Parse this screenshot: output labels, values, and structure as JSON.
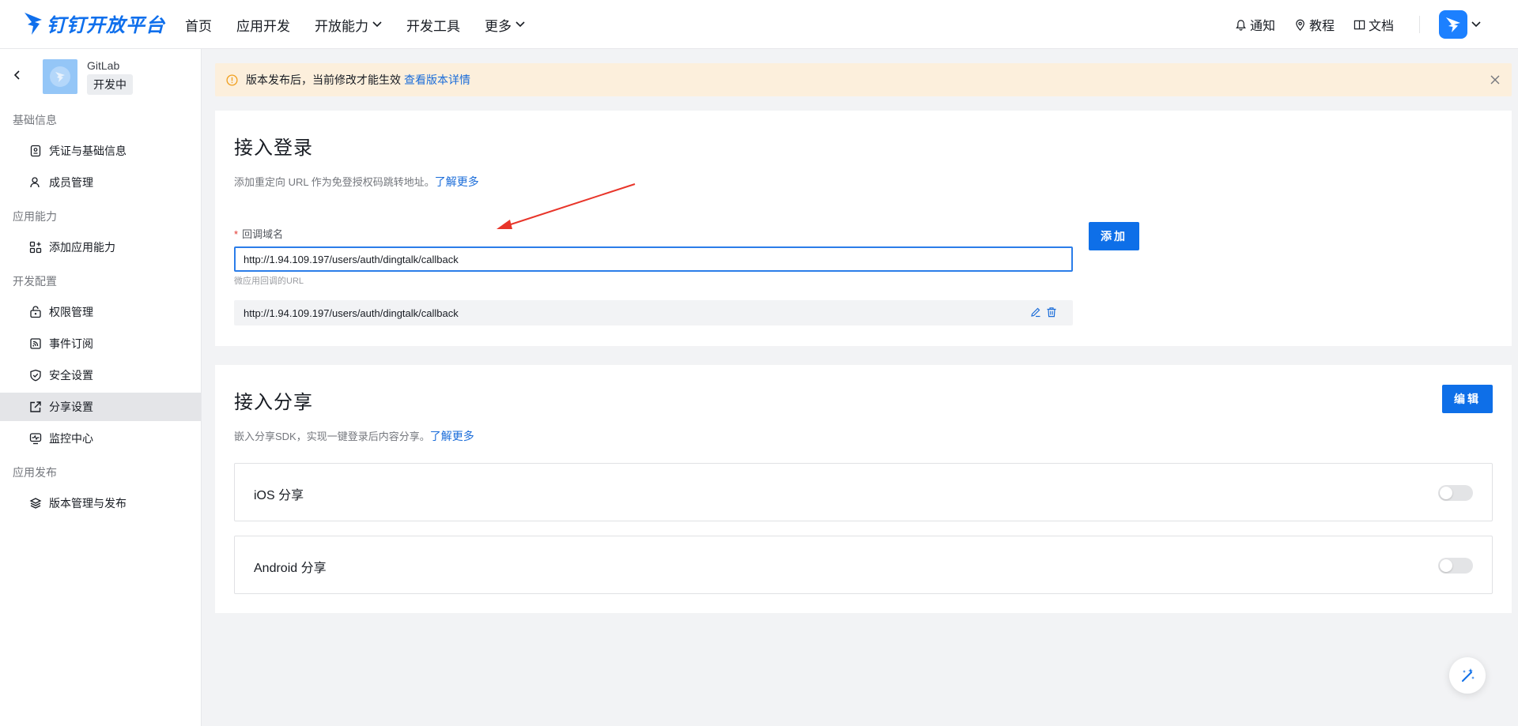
{
  "brand": {
    "name": "钉钉开放平台",
    "color": "#0f6fec",
    "logo_icon": "dingtalk-logo-icon"
  },
  "nav": {
    "items": [
      {
        "label": "首页",
        "has_dropdown": false
      },
      {
        "label": "应用开发",
        "has_dropdown": false
      },
      {
        "label": "开放能力",
        "has_dropdown": true
      },
      {
        "label": "开发工具",
        "has_dropdown": false
      },
      {
        "label": "更多",
        "has_dropdown": true
      }
    ],
    "right": {
      "notify": "通知",
      "tutorial": "教程",
      "docs": "文档"
    }
  },
  "app": {
    "name": "GitLab",
    "status": "开发中"
  },
  "sidebar": {
    "groups": [
      {
        "title": "基础信息",
        "items": [
          {
            "label": "凭证与基础信息",
            "icon": "credential-icon"
          },
          {
            "label": "成员管理",
            "icon": "user-icon"
          }
        ]
      },
      {
        "title": "应用能力",
        "items": [
          {
            "label": "添加应用能力",
            "icon": "apps-add-icon"
          }
        ]
      },
      {
        "title": "开发配置",
        "items": [
          {
            "label": "权限管理",
            "icon": "permission-icon"
          },
          {
            "label": "事件订阅",
            "icon": "event-icon"
          },
          {
            "label": "安全设置",
            "icon": "shield-icon"
          },
          {
            "label": "分享设置",
            "icon": "share-icon",
            "active": true
          },
          {
            "label": "监控中心",
            "icon": "monitor-icon"
          }
        ]
      },
      {
        "title": "应用发布",
        "items": [
          {
            "label": "版本管理与发布",
            "icon": "layers-icon"
          }
        ]
      }
    ]
  },
  "alert": {
    "text": "版本发布后，当前修改才能生效",
    "link": "查看版本详情",
    "background": "#fcefdc",
    "icon_color": "#f0a020"
  },
  "login_card": {
    "title": "接入登录",
    "desc": "添加重定向 URL 作为免登授权码跳转地址。",
    "desc_link": "了解更多",
    "field_label": "回调域名",
    "required_mark": "*",
    "input_value": "http://1.94.109.197/users/auth/dingtalk/callback",
    "field_help": "微应用回调的URL",
    "add_button": "添加",
    "urls": [
      "http://1.94.109.197/users/auth/dingtalk/callback"
    ]
  },
  "share_card": {
    "title": "接入分享",
    "desc": "嵌入分享SDK，实现一键登录后内容分享。",
    "desc_link": "了解更多",
    "edit_button": "编辑",
    "items": [
      {
        "label": "iOS 分享",
        "enabled": false
      },
      {
        "label": "Android 分享",
        "enabled": false
      }
    ]
  },
  "colors": {
    "primary": "#0e6fe8",
    "link": "#1a6cd9",
    "annotation_arrow": "#e8352a"
  }
}
